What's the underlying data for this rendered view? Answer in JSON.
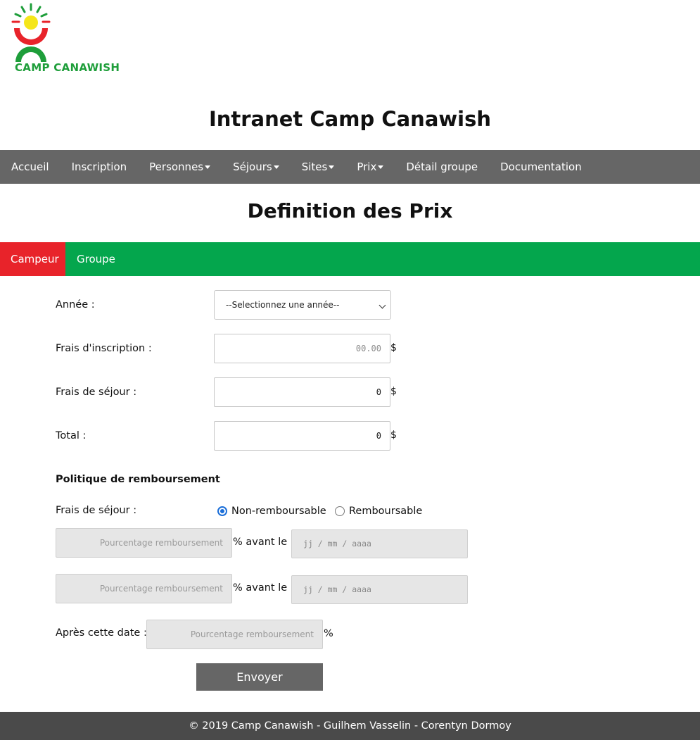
{
  "brand": {
    "logo_text": "CAMP CANAWISH"
  },
  "header": {
    "site_title": "Intranet Camp Canawish"
  },
  "nav": {
    "items": [
      {
        "label": "Accueil",
        "dropdown": false
      },
      {
        "label": "Inscription",
        "dropdown": false
      },
      {
        "label": "Personnes",
        "dropdown": true
      },
      {
        "label": "Séjours",
        "dropdown": true
      },
      {
        "label": "Sites",
        "dropdown": true
      },
      {
        "label": "Prix",
        "dropdown": true
      },
      {
        "label": "Détail groupe",
        "dropdown": false
      },
      {
        "label": "Documentation",
        "dropdown": false
      }
    ]
  },
  "page": {
    "title": "Definition des Prix"
  },
  "tabs": [
    {
      "label": "Campeur",
      "active": true
    },
    {
      "label": "Groupe",
      "active": false
    }
  ],
  "form": {
    "annee": {
      "label": "Année :",
      "selected": "--Selectionnez une année--"
    },
    "frais_inscription": {
      "label": "Frais d'inscription :",
      "placeholder": "00.00",
      "unit": "$"
    },
    "frais_sejour": {
      "label": "Frais de séjour :",
      "value": "0",
      "unit": "$"
    },
    "total": {
      "label": "Total :",
      "value": "0",
      "unit": "$"
    },
    "politique": {
      "heading": "Politique de remboursement",
      "frais_label": "Frais de séjour :",
      "options": [
        {
          "label": "Non-remboursable",
          "checked": true
        },
        {
          "label": "Remboursable",
          "checked": false
        }
      ],
      "rows": [
        {
          "percent_placeholder": "Pourcentage remboursement",
          "avant_label": "% avant le",
          "date_placeholder": "jj / mm / aaaa"
        },
        {
          "percent_placeholder": "Pourcentage remboursement",
          "avant_label": "% avant le",
          "date_placeholder": "jj / mm / aaaa"
        }
      ],
      "apres": {
        "label": "Après cette date :",
        "percent_placeholder": "Pourcentage remboursement",
        "unit": "%"
      }
    },
    "submit_label": "Envoyer"
  },
  "footer": {
    "text": "© 2019 Camp Canawish - Guilhem Vasselin - Corentyn Dormoy"
  },
  "colors": {
    "nav_bg": "#666666",
    "tab_bar_bg": "#04a64d",
    "tab_active_bg": "#e8232a",
    "footer_bg": "#4a4a4a",
    "radio_checked": "#1a6ed8",
    "logo_green": "#1e9e3a",
    "logo_red": "#e8232a",
    "logo_sun": "#f5e61a"
  }
}
